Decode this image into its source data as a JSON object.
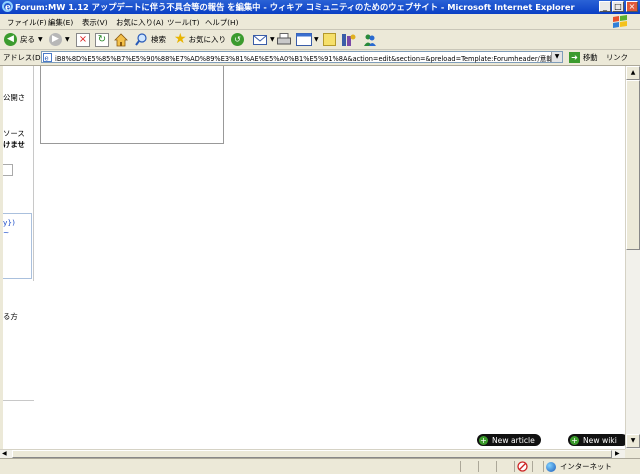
{
  "window": {
    "title": "Forum:MW 1.12 アップデートに伴う不具合等の報告 を編集中 - ウィキア コミュニティのためのウェブサイト - Microsoft Internet Explorer",
    "minimize": "_",
    "maximize": "□",
    "close": "×"
  },
  "menu": [
    "ファイル(F)",
    "編集(E)",
    "表示(V)",
    "お気に入り(A)",
    "ツール(T)",
    "ヘルプ(H)"
  ],
  "toolbar": {
    "back_label": "戻る",
    "search_label": "検索",
    "favorites_label": "お気に入り"
  },
  "address": {
    "label": "アドレス(D)",
    "url": "iB8%8D%E5%85%B7%E5%90%88%E7%AD%89%E3%81%AE%E5%A0%B1%E5%91%8A&action=edit&section=&preload=Template:Forumheader/意翰·鋪区·揖·ː'惲&editintro=",
    "go_label": "移動",
    "links_label": "リンク"
  },
  "left_fragments": [
    "公開さ",
    "ソース",
    "けませ",
    "y})",
    "~",
    "る方"
  ],
  "buttons": {
    "new_article": "New article",
    "new_wiki": "New wiki"
  },
  "status": {
    "zone": "インターネット"
  },
  "colors": {
    "titlebar": "#0a3fc4",
    "chrome": "#ece9d8",
    "link_blue": "#1a4bc8",
    "pill_bg": "#111111",
    "pill_plus": "#3a9a2a"
  }
}
